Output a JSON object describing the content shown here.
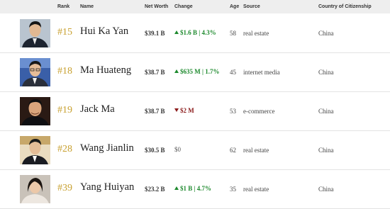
{
  "header": {
    "rank": "Rank",
    "name": "Name",
    "net_worth": "Net Worth",
    "change": "Change",
    "age": "Age",
    "source": "Source",
    "country": "Country of Citizenship"
  },
  "rows": [
    {
      "rank": "#15",
      "name": "Hui Ka Yan",
      "net_worth": "$39.1 B",
      "change": "$1.6 B | 4.3%",
      "change_dir": "up",
      "age": "58",
      "source": "real estate",
      "country": "China"
    },
    {
      "rank": "#18",
      "name": "Ma Huateng",
      "net_worth": "$38.7 B",
      "change": "$635 M | 1.7%",
      "change_dir": "up",
      "age": "45",
      "source": "internet media",
      "country": "China"
    },
    {
      "rank": "#19",
      "name": "Jack Ma",
      "net_worth": "$38.7 B",
      "change": "$2 M",
      "change_dir": "down",
      "age": "53",
      "source": "e-commerce",
      "country": "China"
    },
    {
      "rank": "#28",
      "name": "Wang Jianlin",
      "net_worth": "$30.5 B",
      "change": "$0",
      "change_dir": "flat",
      "age": "62",
      "source": "real estate",
      "country": "China"
    },
    {
      "rank": "#39",
      "name": "Yang Huiyan",
      "net_worth": "$23.2 B",
      "change": "$1 B | 4.7%",
      "change_dir": "up",
      "age": "35",
      "source": "real estate",
      "country": "China"
    }
  ],
  "icons": {
    "change_up": "arrow-up-icon",
    "change_down": "arrow-down-icon"
  },
  "colors": {
    "rank": "#c8a02f",
    "positive": "#1e8a2e",
    "negative": "#8b1a1a",
    "header_bg": "#eeeeee"
  }
}
